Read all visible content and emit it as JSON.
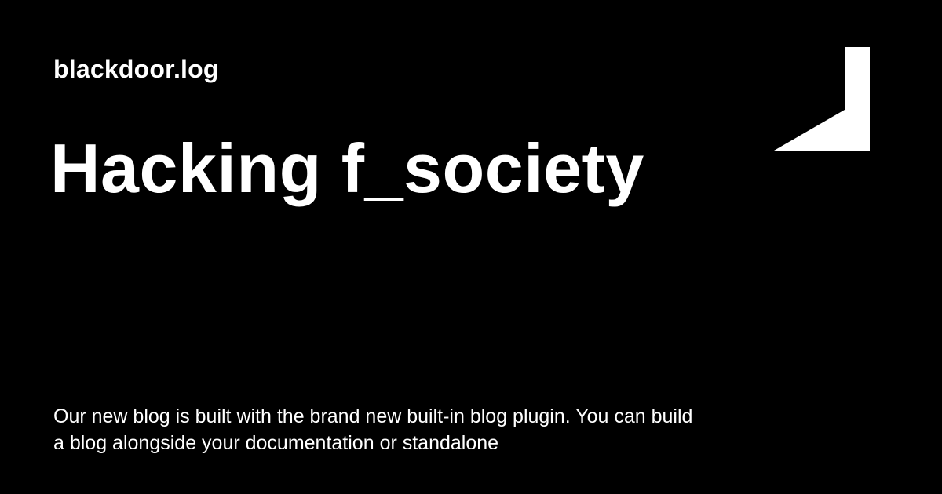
{
  "card": {
    "site_name": "blackdoor.log",
    "headline": "Hacking f_society",
    "description": "Our new blog is built with the brand new built-in blog plugin. You can build a blog alongside your documentation or standalone",
    "logo_icon": "door-logo-icon",
    "background_color": "#000000",
    "text_color": "#ffffff"
  }
}
